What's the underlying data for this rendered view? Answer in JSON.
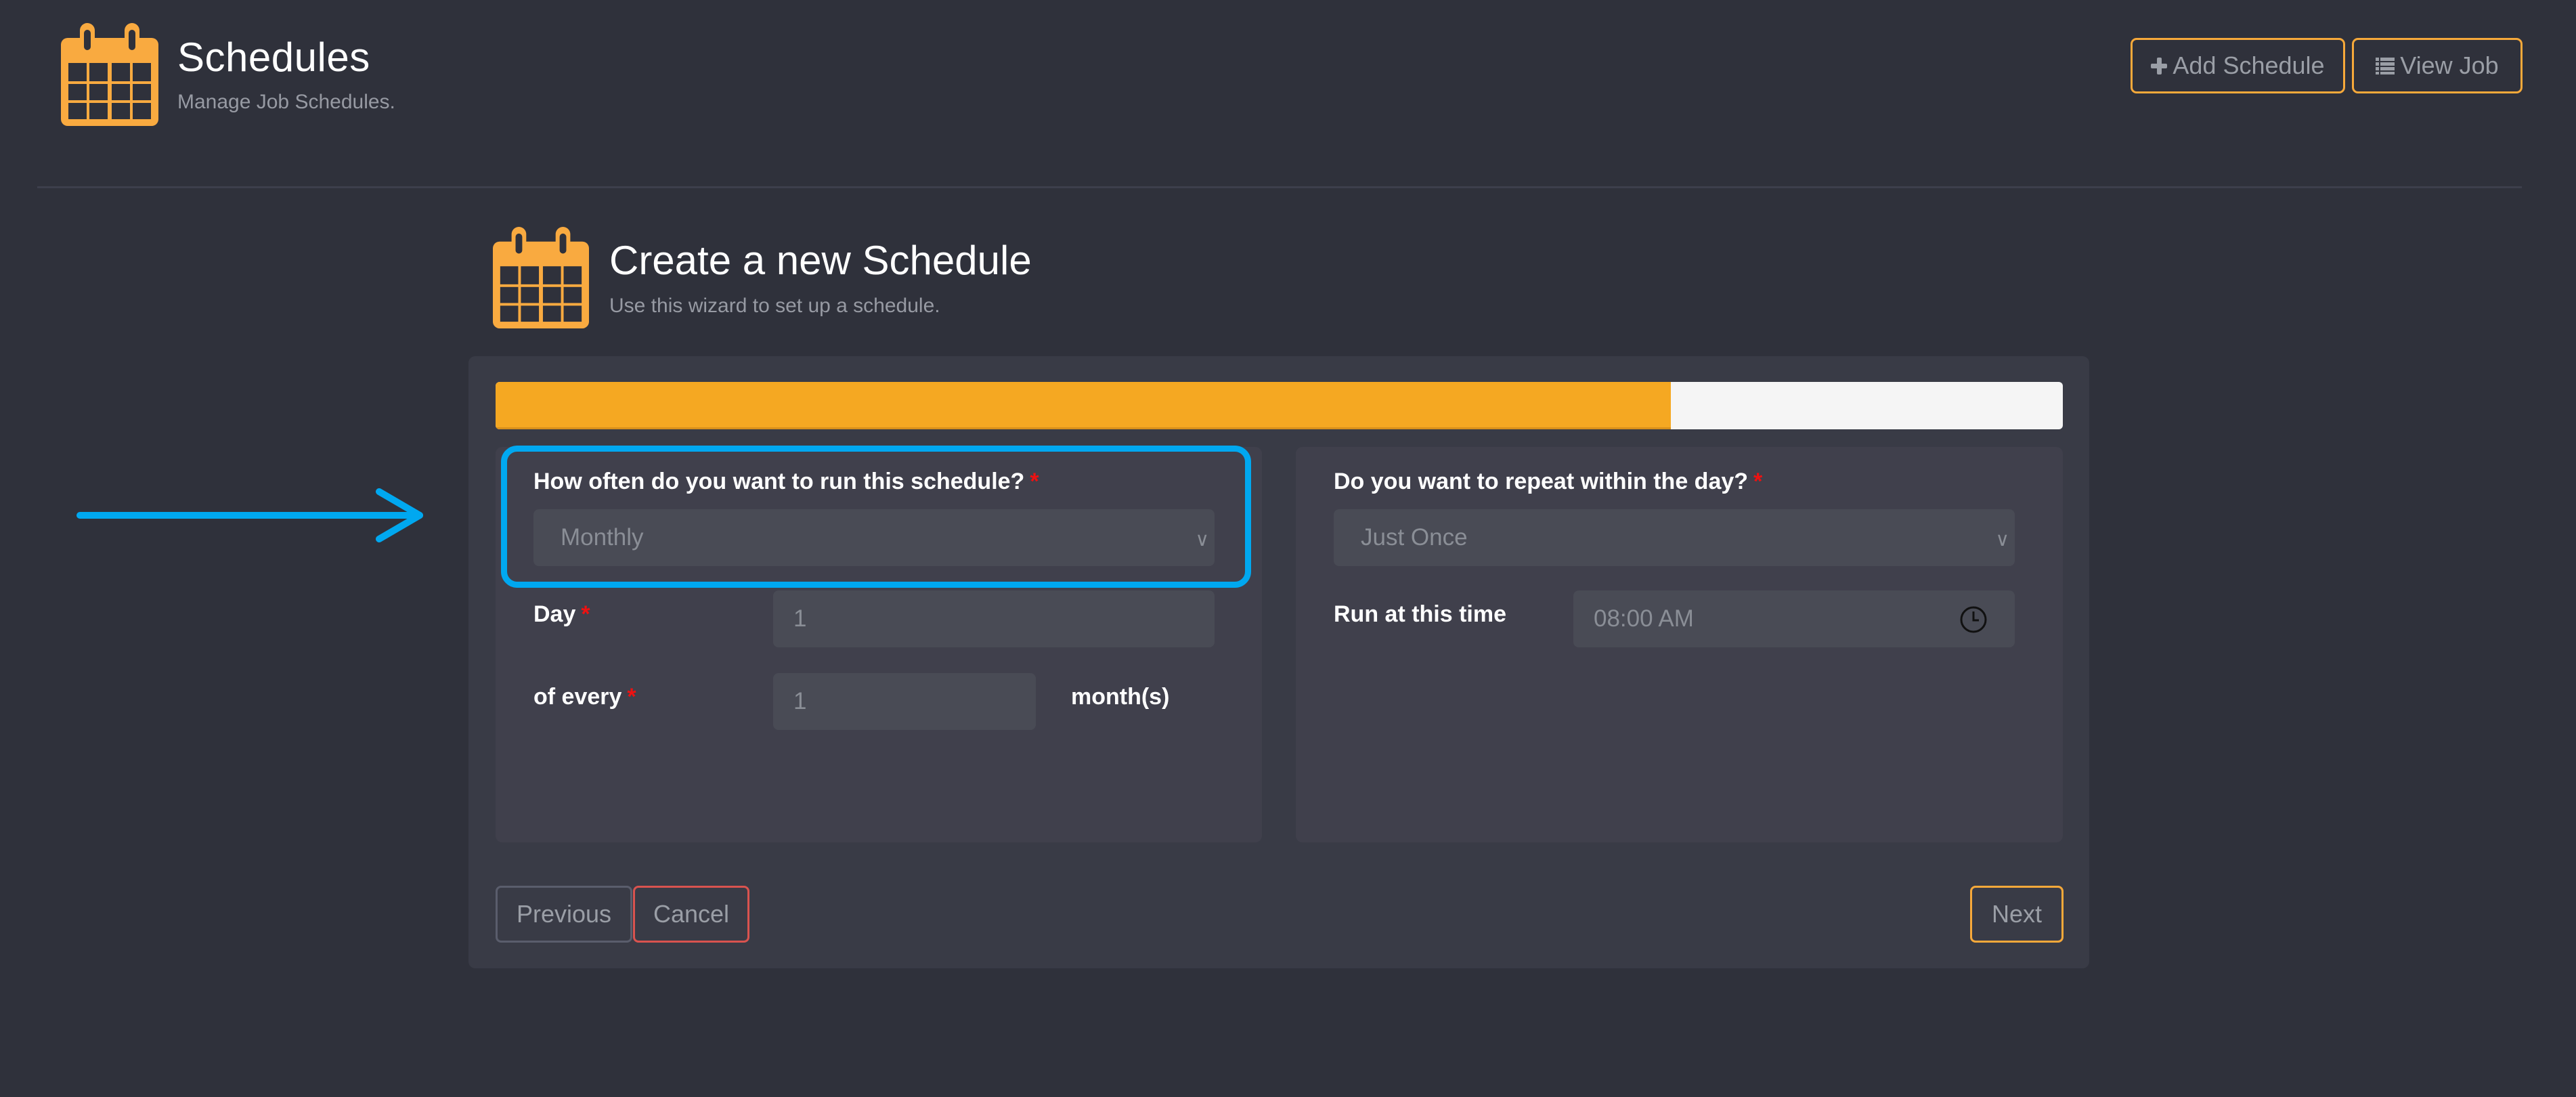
{
  "header": {
    "title": "Schedules",
    "subtitle": "Manage Job Schedules.",
    "icon": "calendar-icon",
    "buttons": [
      {
        "label": "Add Schedule",
        "icon": "plus-icon"
      },
      {
        "label": "View Job",
        "icon": "list-icon"
      }
    ]
  },
  "wizard": {
    "title": "Create a new Schedule",
    "subtitle": "Use this wizard to set up a schedule.",
    "icon": "calendar-icon",
    "progress_percent": 75,
    "left": {
      "frequency_label": "How often do you want to run this schedule?",
      "frequency_value": "Monthly",
      "day_label": "Day",
      "day_value": "1",
      "every_label": "of every",
      "every_value": "1",
      "every_unit": "month(s)"
    },
    "right": {
      "repeat_label": "Do you want to repeat within the day?",
      "repeat_value": "Just Once",
      "time_label": "Run at this time",
      "time_value": "08:00 AM"
    },
    "required_marker": "*",
    "buttons": {
      "previous": "Previous",
      "cancel": "Cancel",
      "next": "Next"
    }
  },
  "annotation": {
    "arrow": "arrow-right-icon",
    "highlight_color": "#00a8f0"
  },
  "colors": {
    "accent": "#f5a822",
    "background": "#2f313b",
    "danger": "#d9534f"
  }
}
